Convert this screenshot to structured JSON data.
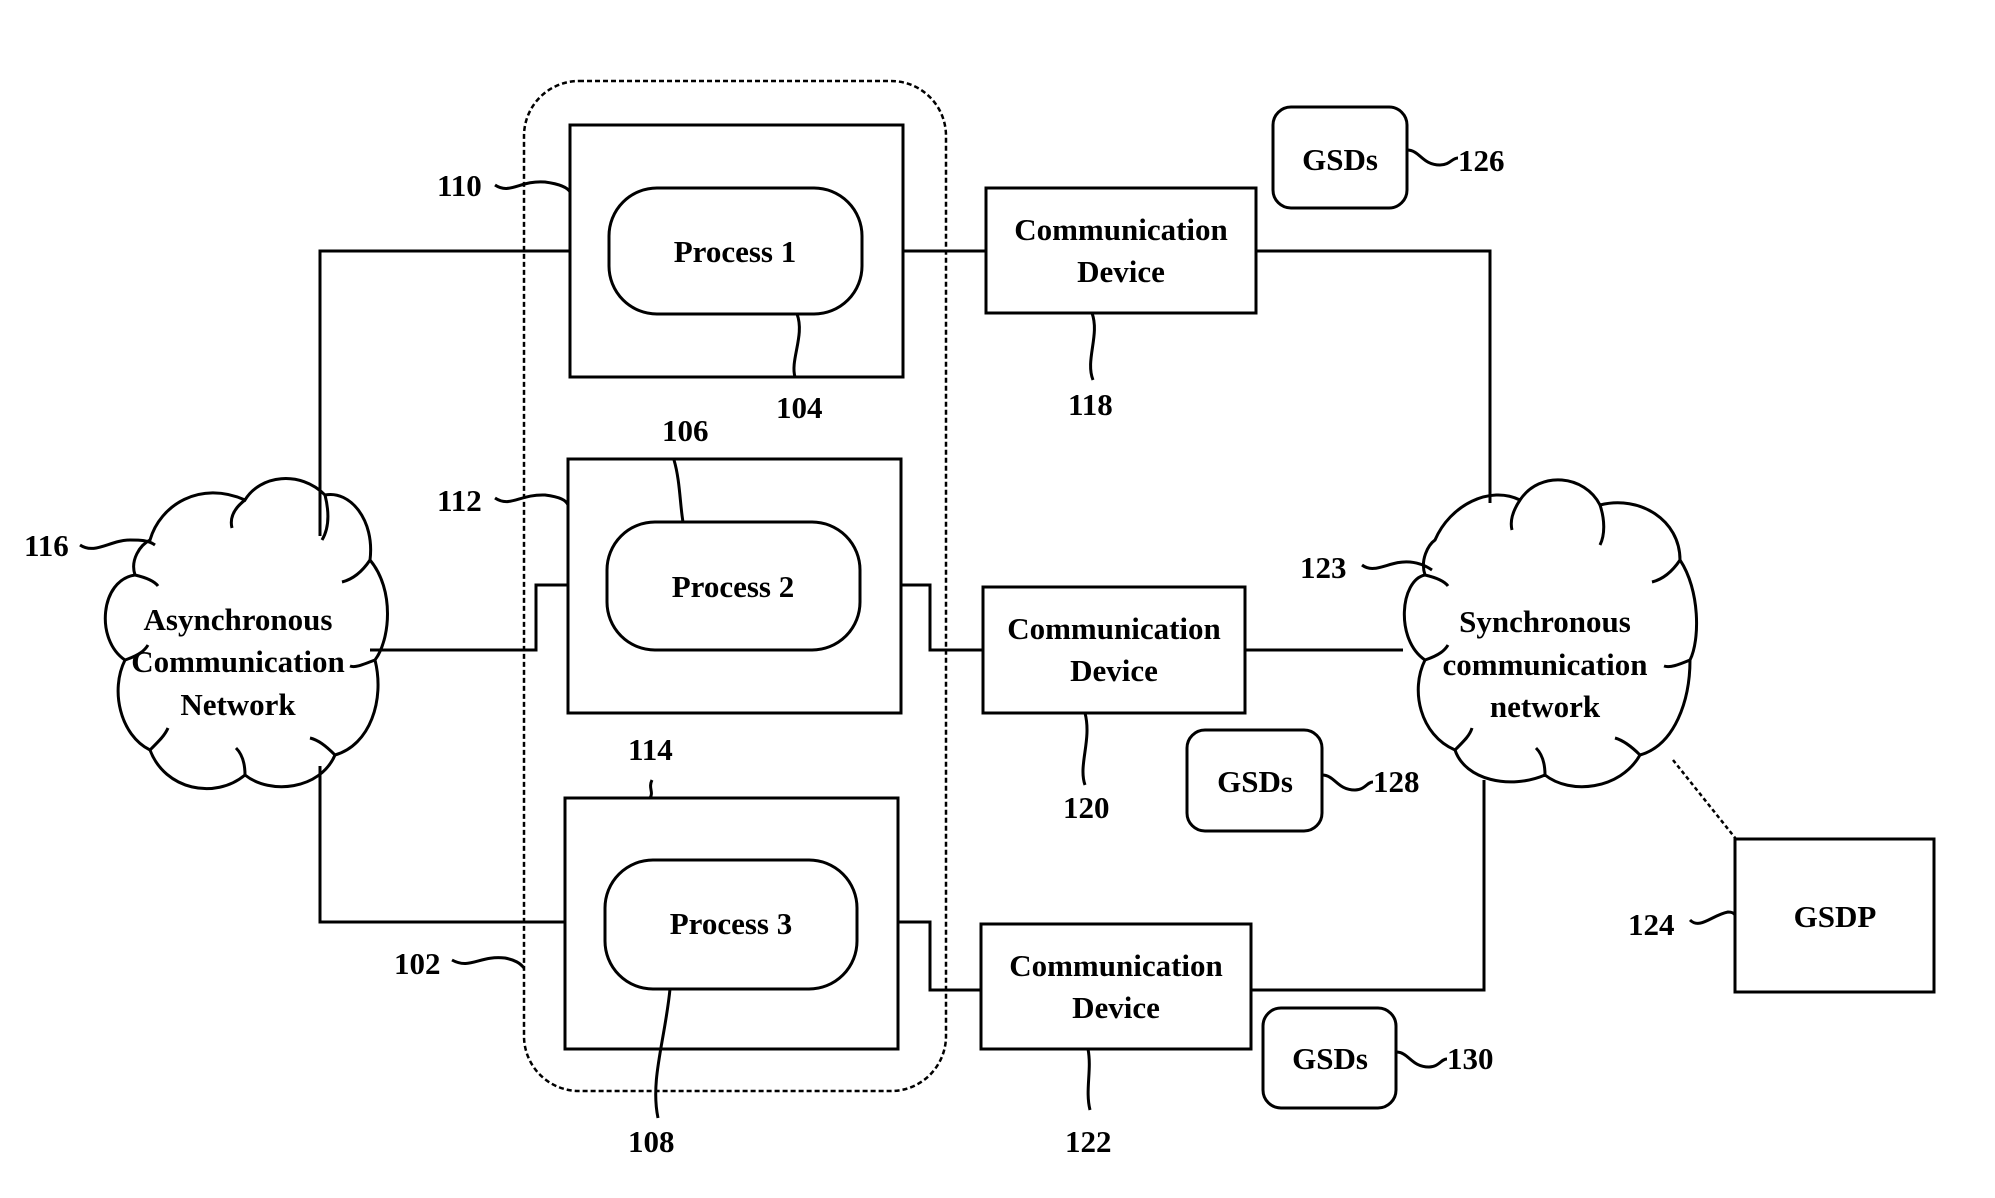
{
  "figure": {
    "container": {
      "ref": "102"
    },
    "async_network": {
      "lines": [
        "Asynchronous",
        "Communication",
        "Network"
      ],
      "ref": "116"
    },
    "sync_network": {
      "lines": [
        "Synchronous",
        "communication",
        "network"
      ],
      "ref": "123"
    },
    "hosts": [
      {
        "ref": "110",
        "process": {
          "label": "Process 1",
          "ref": "104"
        }
      },
      {
        "ref": "112",
        "process": {
          "label": "Process 2",
          "ref": "106"
        }
      },
      {
        "ref": "114",
        "process": {
          "label": "Process 3",
          "ref": "108"
        }
      }
    ],
    "devices": [
      {
        "lines": [
          "Communication",
          "Device"
        ],
        "ref": "118"
      },
      {
        "lines": [
          "Communication",
          "Device"
        ],
        "ref": "120"
      },
      {
        "lines": [
          "Communication",
          "Device"
        ],
        "ref": "122"
      }
    ],
    "gsds": [
      {
        "label": "GSDs",
        "ref": "126"
      },
      {
        "label": "GSDs",
        "ref": "128"
      },
      {
        "label": "GSDs",
        "ref": "130"
      }
    ],
    "gsdp": {
      "label": "GSDP",
      "ref": "124"
    }
  }
}
